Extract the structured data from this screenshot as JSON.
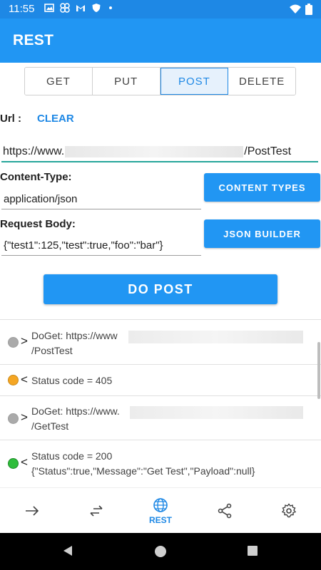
{
  "status_bar": {
    "time": "11:55",
    "icons": [
      "image-icon",
      "pinwheel-icon",
      "gmail-icon",
      "shield-icon",
      "dot-icon"
    ],
    "right_icons": [
      "wifi-icon",
      "battery-icon"
    ]
  },
  "app_bar": {
    "title": "REST"
  },
  "methods": [
    {
      "label": "GET",
      "active": false
    },
    {
      "label": "PUT",
      "active": false
    },
    {
      "label": "POST",
      "active": true
    },
    {
      "label": "DELETE",
      "active": false
    }
  ],
  "url": {
    "label": "Url :",
    "clear_label": "CLEAR",
    "prefix": "https://www.",
    "suffix": "/PostTest"
  },
  "content_type": {
    "label": "Content-Type:",
    "value": "application/json",
    "button": "CONTENT TYPES"
  },
  "request_body": {
    "label": "Request Body:",
    "value": "{\"test1\":125,\"test\":true,\"foo\":\"bar\"}",
    "button": "JSON BUILDER"
  },
  "do_post_label": "DO POST",
  "log": [
    {
      "status": "gray",
      "direction": ">",
      "line1": "DoGet: https://www",
      "line2": "/PostTest"
    },
    {
      "status": "orange",
      "direction": "<",
      "line1": "Status code = 405",
      "line2": ""
    },
    {
      "status": "gray",
      "direction": ">",
      "line1": "DoGet: https://www.",
      "line2": "/GetTest"
    },
    {
      "status": "green",
      "direction": "<",
      "line1": "Status code = 200",
      "line2": "{\"Status\":true,\"Message\":\"Get Test\",\"Payload\":null}"
    }
  ],
  "colors": {
    "gray": "#aaaaaa",
    "orange": "#F5A623",
    "green": "#2EBD3B",
    "accent": "#2196F3"
  },
  "bottom_nav": [
    {
      "icon": "arrow-right-icon",
      "label": ""
    },
    {
      "icon": "swap-arrows-icon",
      "label": ""
    },
    {
      "icon": "globe-icon",
      "label": "REST"
    },
    {
      "icon": "share-icon",
      "label": ""
    },
    {
      "icon": "settings-icon",
      "label": ""
    }
  ]
}
